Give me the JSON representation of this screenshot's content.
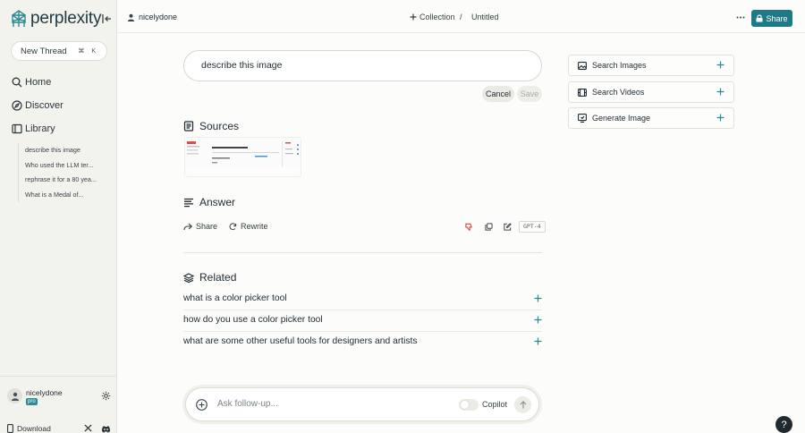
{
  "brand": {
    "name": "perplexity",
    "accent": "#1f7a86"
  },
  "sidebar": {
    "new_thread_label": "New Thread",
    "new_thread_shortcut": "⌘ K",
    "nav": [
      {
        "label": "Home",
        "icon": "search-icon"
      },
      {
        "label": "Discover",
        "icon": "compass-icon"
      },
      {
        "label": "Library",
        "icon": "library-icon"
      }
    ],
    "library_items": [
      "describe this image",
      "Who used the LLM ter...",
      "rephrase it for a 80 yea...",
      "What is a Medal of..."
    ],
    "user": {
      "name": "nicelydone",
      "badge": "pro"
    },
    "download_label": "Download"
  },
  "header": {
    "user": "nicelydone",
    "collection_label": "Collection",
    "separator": "/",
    "title": "Untitled",
    "share_label": "Share"
  },
  "thread": {
    "query": "describe this image",
    "cancel_label": "Cancel",
    "save_label": "Save",
    "sources_title": "Sources",
    "answer_title": "Answer",
    "share_label": "Share",
    "rewrite_label": "Rewrite",
    "model": "GPT-4",
    "related_title": "Related",
    "related": [
      "what is a color picker tool",
      "how do you use a color picker tool",
      "what are some other useful tools for designers and artists"
    ]
  },
  "right_panel": [
    {
      "label": "Search Images",
      "icon": "image-icon"
    },
    {
      "label": "Search Videos",
      "icon": "video-icon"
    },
    {
      "label": "Generate Image",
      "icon": "generate-image-icon"
    }
  ],
  "followup": {
    "placeholder": "Ask follow-up...",
    "copilot_label": "Copilot"
  },
  "help_label": "?"
}
